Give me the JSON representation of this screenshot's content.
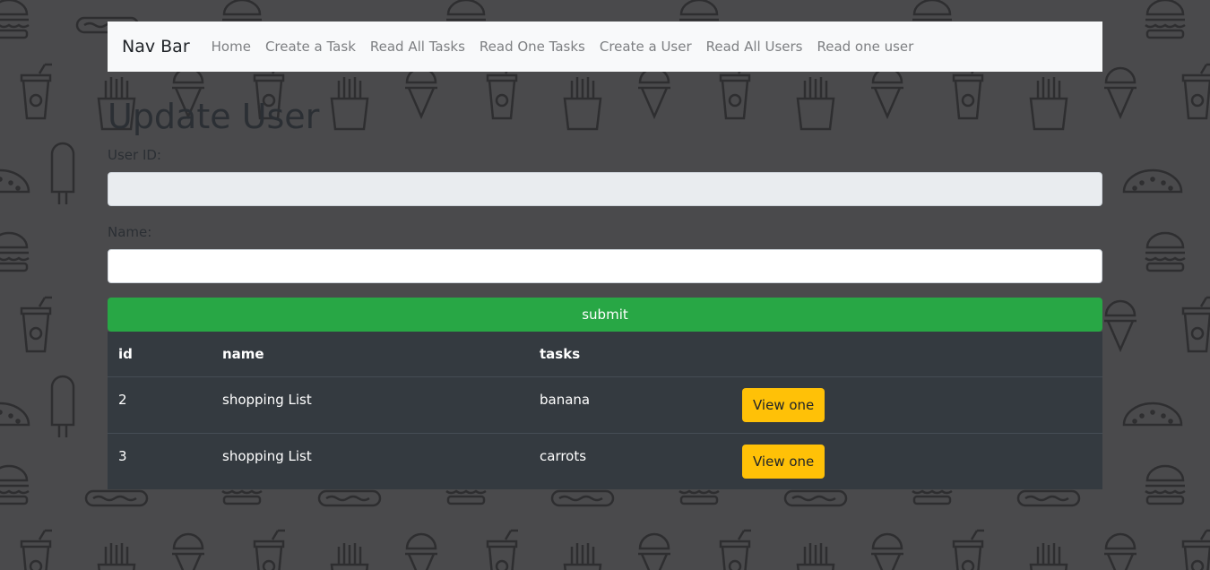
{
  "navbar": {
    "brand": "Nav Bar",
    "links": [
      {
        "label": "Home"
      },
      {
        "label": "Create a Task"
      },
      {
        "label": "Read All Tasks"
      },
      {
        "label": "Read One Tasks"
      },
      {
        "label": "Create a User"
      },
      {
        "label": "Read All Users"
      },
      {
        "label": "Read one user"
      }
    ]
  },
  "form": {
    "title": "Update User",
    "user_id_label": "User ID:",
    "user_id_value": "",
    "name_label": "Name:",
    "name_value": "",
    "submit_label": "submit"
  },
  "table": {
    "headers": [
      "id",
      "name",
      "tasks",
      ""
    ],
    "rows": [
      {
        "id": "2",
        "name": "shopping List",
        "tasks": "banana",
        "action": "View one"
      },
      {
        "id": "3",
        "name": "shopping List",
        "tasks": "carrots",
        "action": "View one"
      }
    ]
  },
  "colors": {
    "background": "#4a4a4c",
    "navbar": "#f8f9fa",
    "submit": "#28a745",
    "table": "#343a40",
    "view_button": "#ffc107"
  },
  "background_icons": [
    "burger-icon",
    "hotdog-icon",
    "soda-cup-icon",
    "fries-icon",
    "ice-cream-icon",
    "popsicle-icon",
    "taco-icon",
    "donut-icon"
  ]
}
